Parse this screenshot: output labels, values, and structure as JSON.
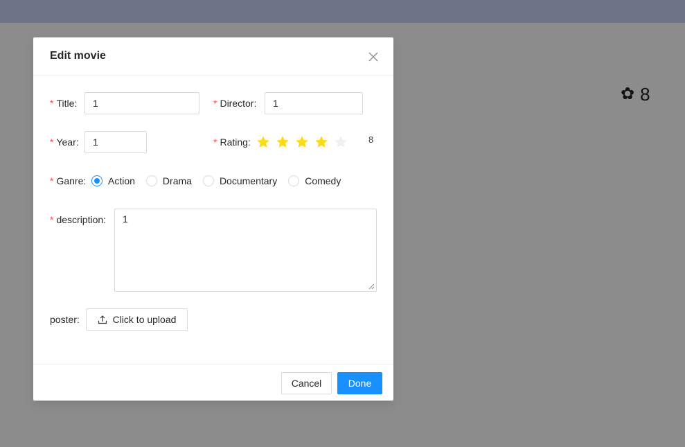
{
  "badge": {
    "icon": "flower-icon",
    "count": "8"
  },
  "modal": {
    "title": "Edit movie",
    "close_icon": "close-icon",
    "required_mark": "*",
    "title_field": {
      "label": "Title:",
      "value": "1"
    },
    "director_field": {
      "label": "Director:",
      "value": "1"
    },
    "year_field": {
      "label": "Year:",
      "value": "1"
    },
    "rating_field": {
      "label": "Rating:",
      "stars_filled": 4,
      "stars_total": 5,
      "value_text": "8"
    },
    "genre_field": {
      "label": "Ganre:",
      "options": [
        "Action",
        "Drama",
        "Documentary",
        "Comedy"
      ],
      "selected": "Action"
    },
    "description_field": {
      "label": "description:",
      "value": "1"
    },
    "poster_field": {
      "label": "poster:",
      "upload_label": "Click to upload",
      "upload_icon": "upload-icon"
    },
    "footer": {
      "cancel_label": "Cancel",
      "done_label": "Done"
    }
  },
  "colors": {
    "primary": "#1890ff",
    "required": "#ff4d4f",
    "star_filled": "#fadb14",
    "star_empty": "#f0f0f0",
    "mask": "#8c8c8c",
    "topbar": "#6d7487"
  }
}
